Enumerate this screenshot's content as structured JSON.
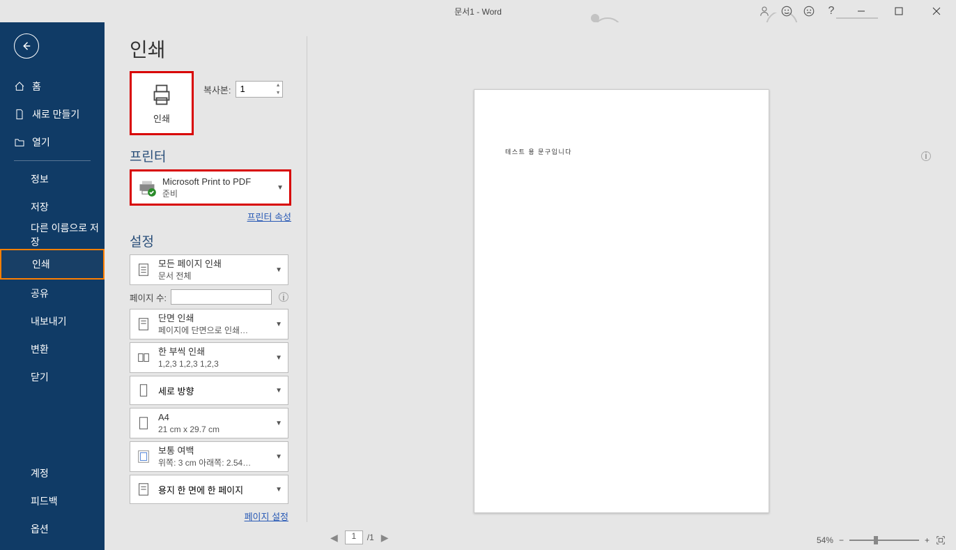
{
  "titlebar": {
    "document_title": "문서1  -  Word",
    "help": "?"
  },
  "sidebar": {
    "home": "홈",
    "new": "새로 만들기",
    "open": "열기",
    "info": "정보",
    "save": "저장",
    "saveas": "다른 이름으로 저장",
    "print": "인쇄",
    "share": "공유",
    "export": "내보내기",
    "transform": "변환",
    "close": "닫기",
    "account": "계정",
    "feedback": "피드백",
    "options": "옵션"
  },
  "print": {
    "title": "인쇄",
    "button_label": "인쇄",
    "copies_label": "복사본:",
    "copies_value": "1",
    "printer_title": "프린터",
    "printer_selected": "Microsoft Print to PDF",
    "printer_status": "준비",
    "printer_props_link": "프린터 속성",
    "settings_title": "설정",
    "setting_pages": {
      "line1": "모든 페이지 인쇄",
      "line2": "문서 전체"
    },
    "pages_label": "페이지 수:",
    "setting_side": {
      "line1": "단면 인쇄",
      "line2": "페이지에 단면으로 인쇄…"
    },
    "setting_collate": {
      "line1": "한 부씩 인쇄",
      "line2": "1,2,3     1,2,3     1,2,3"
    },
    "setting_orient": "세로 방향",
    "setting_paper": {
      "line1": "A4",
      "line2": "21 cm x 29.7 cm"
    },
    "setting_margins": {
      "line1": "보통 여백",
      "line2": "위쪽: 3 cm 아래쪽: 2.54…"
    },
    "setting_sheets": "용지 한 면에 한 페이지",
    "page_setup_link": "페이지 설정"
  },
  "preview": {
    "sample_text": "테스트 용 문구입니다"
  },
  "pager": {
    "current": "1",
    "total": "/1"
  },
  "zoom": {
    "percent": "54%"
  }
}
